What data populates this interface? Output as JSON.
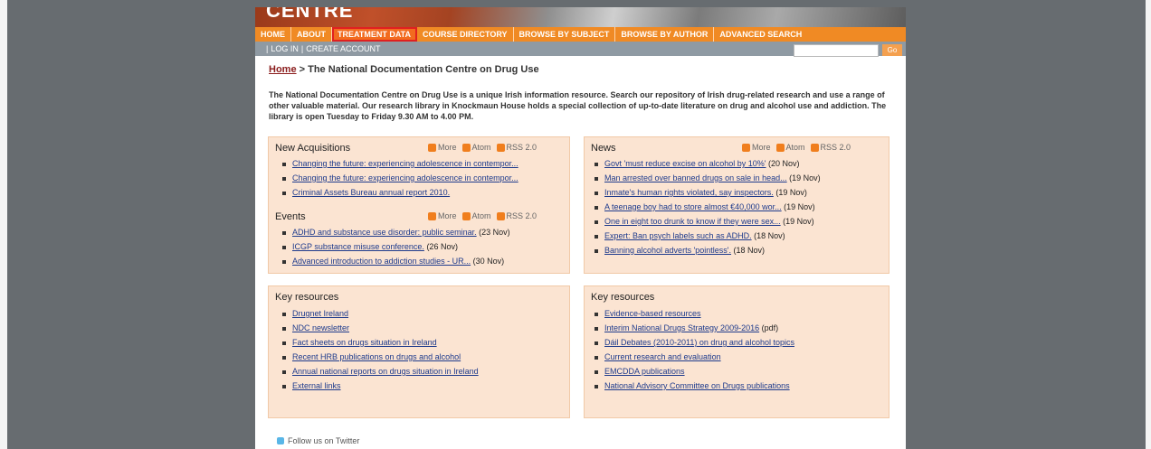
{
  "banner": {
    "title": "CENTRE"
  },
  "nav": [
    "HOME",
    "ABOUT",
    "TREATMENT DATA",
    "COURSE DIRECTORY",
    "BROWSE BY SUBJECT",
    "BROWSE BY AUTHOR",
    "ADVANCED SEARCH"
  ],
  "subnav": {
    "login": "LOG IN",
    "create": "CREATE ACCOUNT",
    "search_button": "Go",
    "search_value": ""
  },
  "breadcrumb": {
    "home": "Home",
    "separator": " > ",
    "current": "The National Documentation Centre on Drug Use"
  },
  "intro": "The National Documentation Centre on Drug Use is a unique Irish information resource. Search our repository of Irish drug-related research and use a range of other valuable material. Our research library in Knockmaun House holds a special collection of up-to-date literature on drug and alcohol use and addiction. The library is open Tuesday to Friday 9.30 AM to 4.00 PM.",
  "feeds": {
    "more": "More",
    "atom": "Atom",
    "rss": "RSS 2.0"
  },
  "acquisitions": {
    "title": "New Acquisitions",
    "items": [
      "Changing the future: experiencing adolescence in contempor...",
      "Changing the future: experiencing adolescence in contempor...",
      "Criminal Assets Bureau annual report 2010."
    ]
  },
  "events": {
    "title": "Events",
    "items": [
      {
        "text": "ADHD and substance use disorder: public seminar.",
        "date": "(23 Nov)"
      },
      {
        "text": "ICGP substance misuse conference.",
        "date": "(26 Nov)"
      },
      {
        "text": "Advanced introduction to addiction studies - UR...",
        "date": "(30 Nov)"
      }
    ]
  },
  "news": {
    "title": "News",
    "items": [
      {
        "text": "Govt 'must reduce excise on alcohol by 10%'",
        "date": "(20 Nov)"
      },
      {
        "text": "Man arrested over banned drugs on sale in head...",
        "date": "(19 Nov)"
      },
      {
        "text": "Inmate's human rights violated, say inspectors.",
        "date": "(19 Nov)"
      },
      {
        "text": "A teenage boy had to store almost €40,000 wor...",
        "date": "(19 Nov)"
      },
      {
        "text": "One in eight too drunk to know if they were sex...",
        "date": "(19 Nov)"
      },
      {
        "text": "Expert: Ban psych labels such as ADHD.",
        "date": "(18 Nov)"
      },
      {
        "text": "Banning alcohol adverts 'pointless'.",
        "date": "(18 Nov)"
      }
    ]
  },
  "key_left": {
    "title": "Key resources",
    "items": [
      "Drugnet Ireland",
      "NDC newsletter",
      "Fact sheets on drugs situation in Ireland",
      "Recent HRB publications on drugs and alcohol",
      "Annual national reports on drugs situation in Ireland",
      "External links"
    ]
  },
  "key_right": {
    "title": "Key resources",
    "items": [
      {
        "text": "Evidence-based resources",
        "suffix": ""
      },
      {
        "text": "Interim National Drugs Strategy 2009-2016",
        "suffix": " (pdf)"
      },
      {
        "text": "Dáil Debates (2010-2011) on drug and alcohol topics",
        "suffix": ""
      },
      {
        "text": "Current research and evaluation",
        "suffix": ""
      },
      {
        "text": "EMCDDA publications",
        "suffix": ""
      },
      {
        "text": "National Advisory Committee on Drugs publications",
        "suffix": ""
      }
    ]
  },
  "twitter": "Follow us on Twitter"
}
